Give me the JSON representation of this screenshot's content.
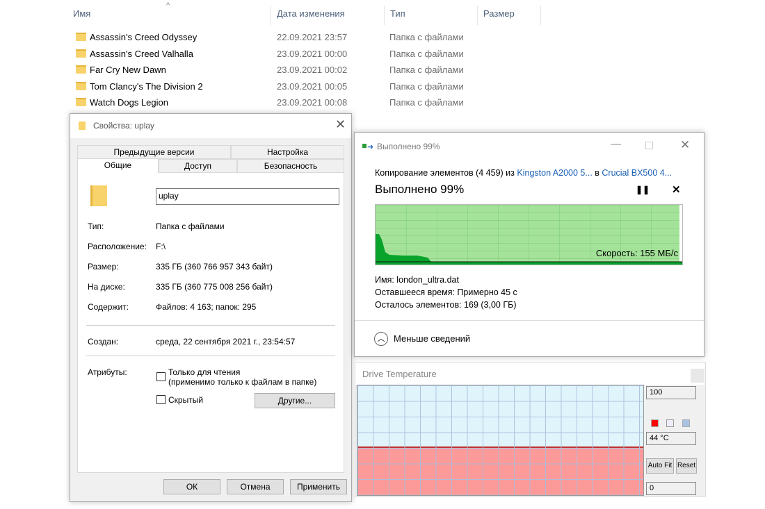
{
  "explorer": {
    "columns": {
      "name": "Имя",
      "date": "Дата изменения",
      "type": "Тип",
      "size": "Размер"
    },
    "rows": [
      {
        "name": "Assassin's Creed Odyssey",
        "date": "22.09.2021 23:57",
        "type": "Папка с файлами"
      },
      {
        "name": "Assassin's Creed Valhalla",
        "date": "23.09.2021 00:00",
        "type": "Папка с файлами"
      },
      {
        "name": "Far Cry New Dawn",
        "date": "23.09.2021 00:02",
        "type": "Папка с файлами"
      },
      {
        "name": "Tom Clancy's The Division 2",
        "date": "23.09.2021 00:05",
        "type": "Папка с файлами"
      },
      {
        "name": "Watch Dogs Legion",
        "date": "23.09.2021 00:08",
        "type": "Папка с файлами"
      }
    ]
  },
  "properties": {
    "title": "Свойства: uplay",
    "tabs": [
      "Предыдущие версии",
      "Настройка",
      "Общие",
      "Доступ",
      "Безопасность"
    ],
    "name_value": "uplay",
    "fields": [
      {
        "label": "Тип:",
        "value": "Папка с файлами"
      },
      {
        "label": "Расположение:",
        "value": "F:\\"
      },
      {
        "label": "Размер:",
        "value": "335 ГБ (360 766 957 343 байт)"
      },
      {
        "label": "На диске:",
        "value": "335 ГБ (360 775 008 256 байт)"
      },
      {
        "label": "Содержит:",
        "value": "Файлов: 4 163; папок: 295"
      }
    ],
    "created_label": "Создан:",
    "created_value": "среда, 22 сентября 2021 г., 23:54:57",
    "attributes_label": "Атрибуты:",
    "readonly_label": "Только для чтения",
    "readonly_note": "(применимо только к файлам в папке)",
    "hidden_label": "Скрытый",
    "other_button": "Другие...",
    "ok": "ОК",
    "cancel": "Отмена",
    "apply": "Применить"
  },
  "copy": {
    "title": "Выполнено 99%",
    "line_prefix": "Копирование элементов (4 459) из ",
    "source": "Kingston A2000 5...",
    "mid": " в ",
    "dest": "Crucial BX500 4...",
    "progress_text": "Выполнено 99%",
    "progress": 99,
    "speed": "Скорость: 155 МБ/с",
    "name_line": "Имя:  london_ultra.dat",
    "time_line": "Оставшееся время:  Примерно 45 с",
    "items_line": "Осталось элементов:  169 (3,00 ГБ)",
    "less_details": "Меньше сведений"
  },
  "temp": {
    "title": "Drive Temperature",
    "max": "100",
    "current": "44 °C",
    "current_value": 44,
    "min": "0",
    "auto_fit": "Auto Fit",
    "reset": "Reset"
  }
}
